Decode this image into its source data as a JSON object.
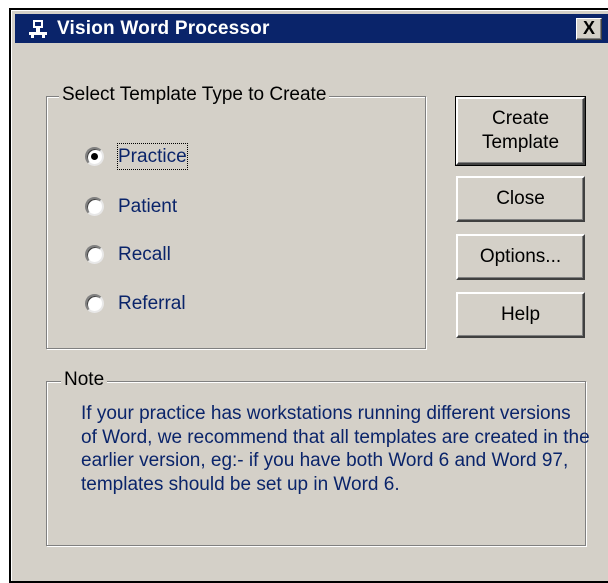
{
  "window": {
    "title": "Vision Word Processor",
    "close_label": "X"
  },
  "template_group": {
    "label": "Select Template Type to Create",
    "options": [
      {
        "label": "Practice",
        "selected": true
      },
      {
        "label": "Patient",
        "selected": false
      },
      {
        "label": "Recall",
        "selected": false
      },
      {
        "label": "Referral",
        "selected": false
      }
    ]
  },
  "buttons": {
    "create_line1": "Create",
    "create_line2": "Template",
    "close": "Close",
    "options": "Options...",
    "help": "Help"
  },
  "note": {
    "label": "Note",
    "text": "If your practice has workstations running different versions of Word, we recommend that all templates are created in the earlier version, eg:- if you have both Word 6 and Word 97, templates should be set up in Word 6."
  },
  "colors": {
    "titlebar": "#0a246a",
    "face": "#d4d0c8",
    "text": "#0a246a"
  }
}
